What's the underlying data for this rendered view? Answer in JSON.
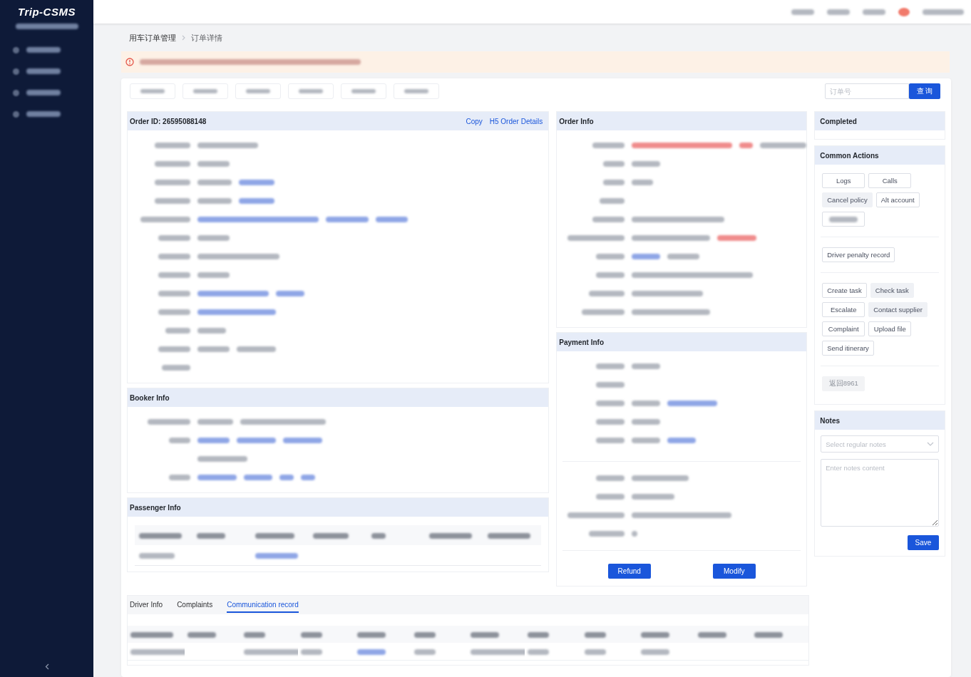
{
  "sidebar": {
    "logo": "Trip-CSMS"
  },
  "breadcrumb": [
    "用车订单管理",
    "订单详情"
  ],
  "search": {
    "placeholder": "订单号",
    "button": "查 询"
  },
  "order_panel": {
    "title": "Order ID: 26595088148",
    "links": [
      "Copy",
      "H5 Order Details"
    ]
  },
  "booker_panel": {
    "title": "Booker Info"
  },
  "passenger_panel": {
    "title": "Passenger Info"
  },
  "order_info": {
    "title": "Order Info"
  },
  "payment_info": {
    "title": "Payment Info",
    "buttons": [
      "Refund",
      "Modify"
    ]
  },
  "status": {
    "title": "Completed"
  },
  "common_actions": {
    "title": "Common Actions",
    "groups": [
      [
        {
          "label": "Logs",
          "kind": "outline"
        },
        {
          "label": "Calls",
          "kind": "outline"
        },
        {
          "label": "Cancel policy",
          "kind": "plain"
        },
        {
          "label": "Alt account",
          "kind": "outline"
        },
        {
          "kind": "blurred"
        }
      ],
      [
        {
          "label": "Driver penalty record",
          "kind": "outline"
        }
      ],
      [
        {
          "label": "Create task",
          "kind": "outline"
        },
        {
          "label": "Check task",
          "kind": "plain"
        },
        {
          "label": "Escalate",
          "kind": "outline"
        },
        {
          "label": "Contact supplier",
          "kind": "plain"
        },
        {
          "label": "Complaint",
          "kind": "outline"
        },
        {
          "label": "Upload file",
          "kind": "outline"
        },
        {
          "label": "Send itinerary",
          "kind": "outline"
        }
      ],
      [
        {
          "label": "返回8961",
          "kind": "outline",
          "disabled": true
        }
      ]
    ]
  },
  "notes": {
    "title": "Notes",
    "select_placeholder": "Select regular notes",
    "text_placeholder": "Enter notes content",
    "button": "Save"
  },
  "bottom_tabs": [
    {
      "label": "Driver Info",
      "selected": false
    },
    {
      "label": "Complaints",
      "selected": false
    },
    {
      "label": "Communication record",
      "selected": true
    }
  ]
}
